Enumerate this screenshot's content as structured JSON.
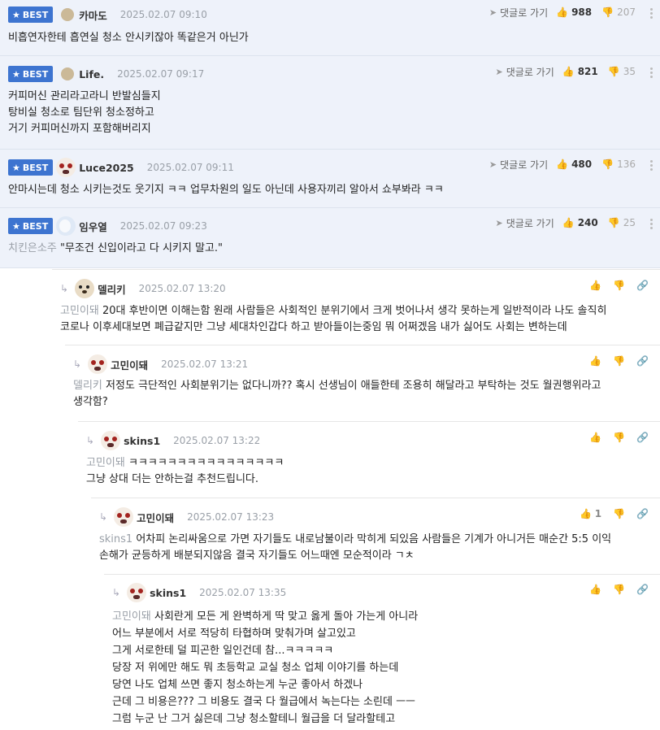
{
  "best_badge": "BEST",
  "reply_link_label": "댓글로 가기",
  "best_comments": [
    {
      "nick": "카마도",
      "date": "2025.02.07 09:10",
      "up": "988",
      "down": "207",
      "text": "비흡연자한테 흡연실 청소 안시키잖아 똑같은거 아닌가",
      "avatar": "dot"
    },
    {
      "nick": "Life.",
      "date": "2025.02.07 09:17",
      "up": "821",
      "down": "35",
      "text": "커피머신 관리라고라니 반발심들지\n탕비실 청소로 팀단위 청소정하고\n거기 커피머신까지 포함해버리지",
      "avatar": "dot"
    },
    {
      "nick": "Luce2025",
      "date": "2025.02.07 09:11",
      "up": "480",
      "down": "136",
      "text": "안마시는데 청소 시키는것도 웃기지 ㅋㅋ 업무차원의 일도 아닌데 사용자끼리 알아서 쇼부봐라 ㅋㅋ",
      "avatar": "red"
    },
    {
      "nick": "임우열",
      "date": "2025.02.07 09:23",
      "up": "240",
      "down": "25",
      "mention": "치킨은소주",
      "text": "\"무조건 신입이라고 다 시키지 말고.\"",
      "avatar": "snow"
    }
  ],
  "replies": [
    {
      "nick": "델리키",
      "date": "2025.02.07 13:20",
      "mention": "고민이돼",
      "text": "20대 후반이면 이해는함 원래 사람들은 사회적인 분위기에서 크게 벗어나서 생각 못하는게 일반적이라 나도 솔직히\n코로나 이후세대보면 폐급같지만 그냥 세대차인갑다 하고 받아들이는중임 뭐 어쩌겠음 내가 싫어도 사회는 변하는데",
      "up": "",
      "avatar": "dog"
    },
    {
      "nick": "고민이돼",
      "date": "2025.02.07 13:21",
      "mention": "델리키",
      "text": "저정도 극단적인 사회분위기는 없다니까?? 혹시 선생님이 애들한테 조용히 해달라고 부탁하는 것도 월권행위라고\n생각함?",
      "up": "",
      "avatar": "red"
    },
    {
      "nick": "skins1",
      "date": "2025.02.07 13:22",
      "mention": "고민이돼",
      "text": "ㅋㅋㅋㅋㅋㅋㅋㅋㅋㅋㅋㅋㅋㅋㅋㅋ\n그냥 상대 더는 안하는걸 추천드립니다.",
      "up": "",
      "avatar": "red"
    },
    {
      "nick": "고민이돼",
      "date": "2025.02.07 13:23",
      "mention": "skins1",
      "text": "어차피 논리싸움으로 가면 자기들도 내로남불이라 막히게 되있음 사람들은 기계가 아니거든 매순간 5:5 이익\n손해가 균등하게 배분되지않음 결국 자기들도 어느때엔 모순적이라 ㄱㅊ",
      "up": "1",
      "avatar": "red"
    },
    {
      "nick": "skins1",
      "date": "2025.02.07 13:35",
      "mention": "고민이돼",
      "text": "사회란게 모든 게 완벽하게 딱 맞고 옳게 돌아 가는게 아니라\n어느 부분에서 서로 적당히 타협하며 맞춰가며 살고있고\n그게 서로한테 덜 피곤한 일인건데 참...ㅋㅋㅋㅋㅋ\n당장 저 위에만 해도 뭐 초등학교 교실 청소 업체 이야기를 하는데\n당연 나도 업체 쓰면 좋지 청소하는게 누군 좋아서 하겠나\n근데 그 비용은??? 그 비용도 결국 다 월급에서 녹는다는 소린데 ㅡㅡ\n그럼 누군 난 그거 싫은데 그냥 청소할테니 월급을 더 달라할테고",
      "up": "",
      "avatar": "red"
    }
  ]
}
